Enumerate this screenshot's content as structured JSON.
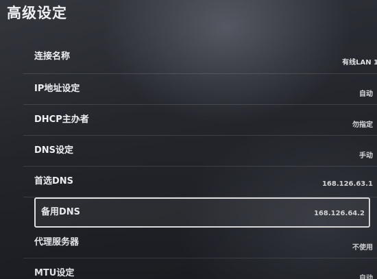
{
  "header": {
    "title": "高级设定"
  },
  "settings": {
    "items": [
      {
        "label": "连接名称",
        "value": "有线LAN 1"
      },
      {
        "label": "IP地址设定",
        "value": "自动"
      },
      {
        "label": "DHCP主办者",
        "value": "勿指定"
      },
      {
        "label": "DNS设定",
        "value": "手动"
      },
      {
        "label": "首选DNS",
        "value": "168.126.63.1"
      },
      {
        "label": "备用DNS",
        "value": "168.126.64.2",
        "selected": true
      },
      {
        "label": "代理服务器",
        "value": "不使用"
      },
      {
        "label": "MTU设定",
        "value": "自动"
      }
    ]
  }
}
